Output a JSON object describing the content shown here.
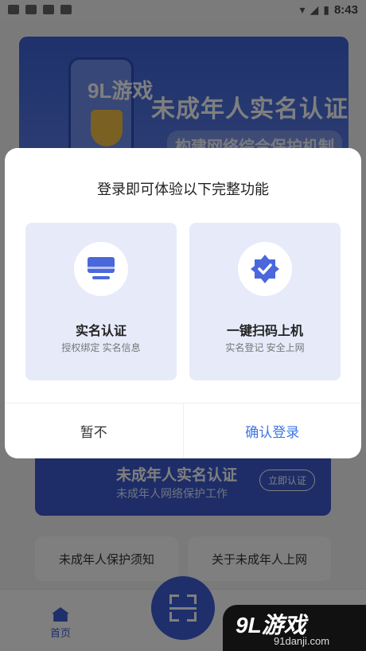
{
  "status_bar": {
    "time": "8:43"
  },
  "banner": {
    "logo": "9L游戏",
    "title": "未成年人实名认证",
    "subtitle": "构建网络综合保护机制"
  },
  "card": {
    "title": "未成年人实名认证",
    "subtitle": "未成年人网络保护工作",
    "button": "立即认证"
  },
  "quick_links": [
    {
      "label": "未成年人保护须知"
    },
    {
      "label": "关于未成年人上网"
    }
  ],
  "tab_bar": {
    "home_label": "首页"
  },
  "dialog": {
    "title": "登录即可体验以下完整功能",
    "features": [
      {
        "title": "实名认证",
        "desc": "授权绑定 实名信息",
        "icon": "monitor-icon"
      },
      {
        "title": "一键扫码上机",
        "desc": "实名登记 安全上网",
        "icon": "badge-check-icon"
      }
    ],
    "cancel_label": "暂不",
    "confirm_label": "确认登录"
  },
  "watermark": {
    "brand": "9L游戏",
    "site": "91danji.com"
  },
  "colors": {
    "accent": "#3f5fd6",
    "link": "#3f76e0",
    "feature_bg": "#e6eaf9"
  }
}
